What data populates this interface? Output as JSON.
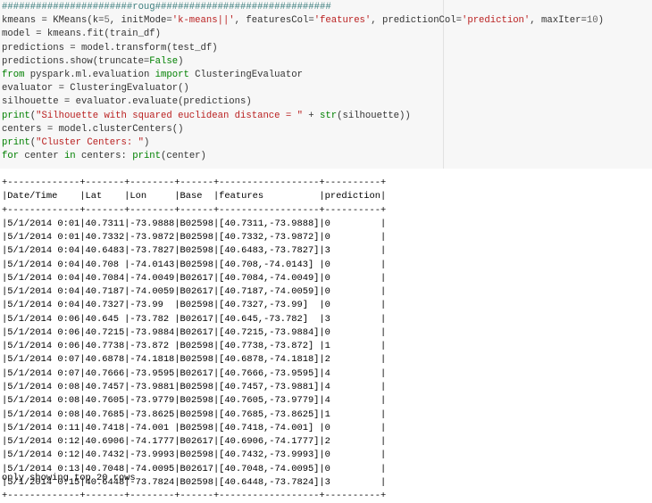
{
  "code_cell": {
    "line1": {
      "comment": "#######################roug###############################",
      "kmeans_prefix": "kmeans = KMeans(k=",
      "k_value": "5",
      "init_arg": ", initMode=",
      "init_str": "'k-means||'",
      "feat_arg": ", featuresCol=",
      "feat_str": "'features'",
      "pred_arg": ", predictionCol=",
      "pred_str": "'prediction'",
      "iter_arg": ", maxIter=",
      "iter_value": "10",
      "close": ")"
    },
    "line_fit": "model = kmeans.fit(train_df)",
    "line_transform": "predictions = model.transform(test_df)",
    "line_show_prefix": "predictions.show(truncate=",
    "line_show_false": "False",
    "line_show_close": ")",
    "line_import_from": "from",
    "line_import_module": " pyspark.ml.evaluation ",
    "line_import_kw": "import",
    "line_import_name": " ClusteringEvaluator",
    "line_eval": "evaluator = ClusteringEvaluator()",
    "line_sil": "silhouette = evaluator.evaluate(predictions)",
    "line_print1_fn": "print",
    "line_print1_open": "(",
    "line_print1_str": "\"Silhouette with squared euclidean distance = \"",
    "line_print1_plus": " + ",
    "line_print1_str_fn": "str",
    "line_print1_rest": "(silhouette))",
    "line_centers": "centers = model.clusterCenters()",
    "line_print2_fn": "print",
    "line_print2_open": "(",
    "line_print2_str": "\"Cluster Centers: \"",
    "line_print2_close": ")",
    "line_for_kw": "for",
    "line_for_mid": " center ",
    "line_for_in": "in",
    "line_for_rest": " centers: ",
    "line_for_print": "print",
    "line_for_end": "(center)"
  },
  "output": {
    "separator": "+-------------+-------+--------+------+------------------+----------+",
    "header": "|Date/Time    |Lat    |Lon     |Base  |features          |prediction|",
    "rows": [
      "|5/1/2014 0:01|40.7311|-73.9888|B02598|[40.7311,-73.9888]|0         |",
      "|5/1/2014 0:01|40.7332|-73.9872|B02598|[40.7332,-73.9872]|0         |",
      "|5/1/2014 0:04|40.6483|-73.7827|B02598|[40.6483,-73.7827]|3         |",
      "|5/1/2014 0:04|40.708 |-74.0143|B02598|[40.708,-74.0143] |0         |",
      "|5/1/2014 0:04|40.7084|-74.0049|B02617|[40.7084,-74.0049]|0         |",
      "|5/1/2014 0:04|40.7187|-74.0059|B02617|[40.7187,-74.0059]|0         |",
      "|5/1/2014 0:04|40.7327|-73.99  |B02598|[40.7327,-73.99]  |0         |",
      "|5/1/2014 0:06|40.645 |-73.782 |B02617|[40.645,-73.782]  |3         |",
      "|5/1/2014 0:06|40.7215|-73.9884|B02617|[40.7215,-73.9884]|0         |",
      "|5/1/2014 0:06|40.7738|-73.872 |B02598|[40.7738,-73.872] |1         |",
      "|5/1/2014 0:07|40.6878|-74.1818|B02598|[40.6878,-74.1818]|2         |",
      "|5/1/2014 0:07|40.7666|-73.9595|B02617|[40.7666,-73.9595]|4         |",
      "|5/1/2014 0:08|40.7457|-73.9881|B02598|[40.7457,-73.9881]|4         |",
      "|5/1/2014 0:08|40.7605|-73.9779|B02598|[40.7605,-73.9779]|4         |",
      "|5/1/2014 0:08|40.7685|-73.8625|B02598|[40.7685,-73.8625]|1         |",
      "|5/1/2014 0:11|40.7418|-74.001 |B02598|[40.7418,-74.001] |0         |",
      "|5/1/2014 0:12|40.6906|-74.1777|B02617|[40.6906,-74.1777]|2         |",
      "|5/1/2014 0:12|40.7432|-73.9993|B02598|[40.7432,-73.9993]|0         |",
      "|5/1/2014 0:13|40.7048|-74.0095|B02617|[40.7048,-74.0095]|0         |",
      "|5/1/2014 0:15|40.6448|-73.7824|B02598|[40.6448,-73.7824]|3         |"
    ],
    "footer": "only showing top 20 rows"
  },
  "colors": {
    "code_bg": "#f7f7f7",
    "keyword": "#008000",
    "string": "#ba2121",
    "comment": "#408080"
  }
}
